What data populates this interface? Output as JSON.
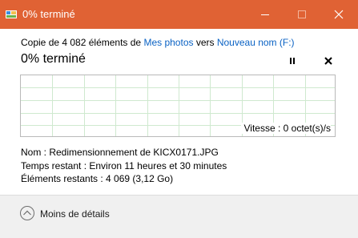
{
  "window": {
    "title": "0% terminé",
    "accent": "#e06234"
  },
  "copy": {
    "prefix": "Copie de 4 082 éléments de ",
    "source": "Mes photos",
    "middle": " vers ",
    "destination": "Nouveau nom (F:)"
  },
  "progress": {
    "title": "0% terminé",
    "percent": 0,
    "speed": "Vitesse : 0 octet(s)/s"
  },
  "details": {
    "name": "Nom :  Redimensionnement de KICX0171.JPG",
    "time": "Temps restant :  Environ 11 heures et 30 minutes",
    "items": "Éléments restants :  4 069 (3,12 Go)"
  },
  "footer": {
    "less_details": "Moins de détails"
  },
  "icons": {
    "app": "file-copy-icon",
    "pause": "pause-icon",
    "cancel": "close-icon",
    "toggle": "chevron-up-circle-icon"
  }
}
